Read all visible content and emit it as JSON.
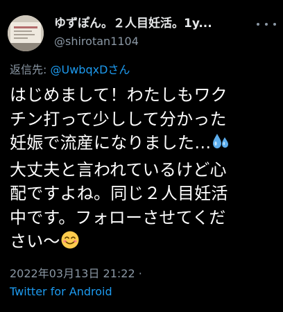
{
  "tweet": {
    "display_name": "ゆずぽん。２人目妊活。1y...",
    "handle": "@shirotan1104",
    "reply_prefix": "返信先: ",
    "reply_mention": "@UwbqxDさん",
    "lines": [
      "はじめまして！わたしもワク",
      "チン打って少しして分かった",
      "妊娠で流産になりました…",
      "大丈夫と言われているけど心",
      "配ですよね。同じ２人目妊活",
      "中です。フォローさせてくだ",
      "さい〜"
    ],
    "timestamp": "2022年03月13日 21:22 ·",
    "source": "Twitter for Android"
  },
  "colors": {
    "background": "#000000",
    "text": "#ffffff",
    "secondary": "#8b98a5",
    "link": "#1d9bf0"
  },
  "icons": {
    "sweat": "sweat-droplets-icon",
    "smile": "smiling-face-icon",
    "more": "more-options-icon"
  }
}
